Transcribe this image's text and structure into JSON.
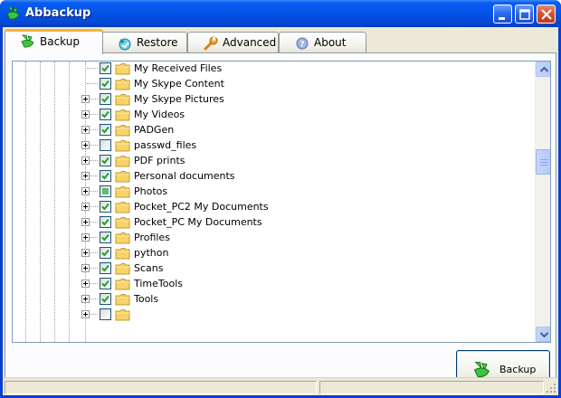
{
  "window": {
    "title": "Abbackup",
    "controls": [
      "minimize",
      "maximize",
      "close"
    ]
  },
  "tabs": [
    {
      "label": "Backup",
      "icon": "backup-icon",
      "active": true
    },
    {
      "label": "Restore",
      "icon": "restore-icon",
      "active": false
    },
    {
      "label": "Advanced",
      "icon": "wrench-icon",
      "active": false
    },
    {
      "label": "About",
      "icon": "help-icon",
      "active": false
    }
  ],
  "tree": {
    "items": [
      {
        "label": "My Received Files",
        "checked": "checked",
        "expandable": false
      },
      {
        "label": "My Skype Content",
        "checked": "checked",
        "expandable": false
      },
      {
        "label": "My Skype Pictures",
        "checked": "checked",
        "expandable": true
      },
      {
        "label": "My Videos",
        "checked": "checked",
        "expandable": true
      },
      {
        "label": "PADGen",
        "checked": "checked",
        "expandable": true
      },
      {
        "label": "passwd_files",
        "checked": "unchecked",
        "expandable": true
      },
      {
        "label": "PDF prints",
        "checked": "checked",
        "expandable": true
      },
      {
        "label": "Personal documents",
        "checked": "checked",
        "expandable": true
      },
      {
        "label": "Photos",
        "checked": "partial",
        "expandable": true
      },
      {
        "label": "Pocket_PC2 My Documents",
        "checked": "checked",
        "expandable": true
      },
      {
        "label": "Pocket_PC My Documents",
        "checked": "checked",
        "expandable": true
      },
      {
        "label": "Profiles",
        "checked": "checked",
        "expandable": true
      },
      {
        "label": "python",
        "checked": "checked",
        "expandable": true
      },
      {
        "label": "Scans",
        "checked": "checked",
        "expandable": true
      },
      {
        "label": "TimeTools",
        "checked": "checked",
        "expandable": true
      },
      {
        "label": "Tools",
        "checked": "checked",
        "expandable": true
      },
      {
        "label": "",
        "checked": "unchecked",
        "expandable": true
      }
    ]
  },
  "actions": {
    "backup_label": "Backup"
  },
  "colors": {
    "title_bar": "#0453e6",
    "active_tab_accent": "#f6b23c",
    "check_mark": "#21a121",
    "folder": "#f7d46a"
  }
}
